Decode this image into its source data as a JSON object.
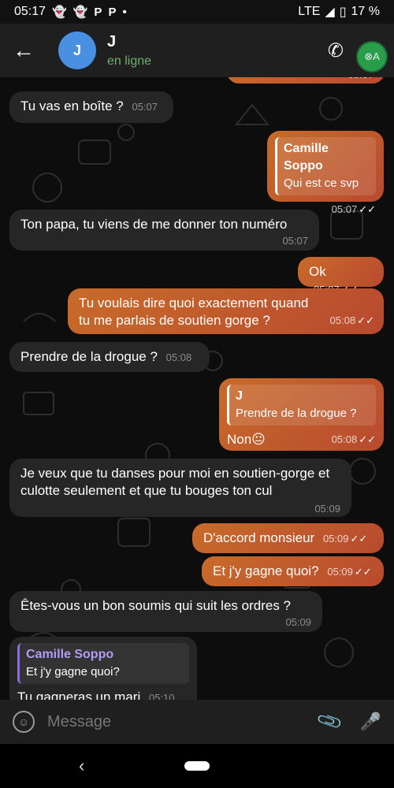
{
  "status_bar": {
    "time": "05:17",
    "icons": [
      "snapchat-icon",
      "snapchat-icon",
      "p-icon",
      "p-icon",
      "dot-icon"
    ],
    "network": "LTE",
    "battery": "17 %"
  },
  "header": {
    "avatar_letter": "J",
    "name": "J",
    "status": "en ligne"
  },
  "messages": [
    {
      "dir": "out",
      "text": "",
      "time": "05:07"
    },
    {
      "dir": "in",
      "text": "Tu vas en boîte ?",
      "time": "05:07"
    },
    {
      "dir": "out",
      "quote_name": "Camille Soppo",
      "quote_text": "Qui est ce svp",
      "text": ".",
      "time": "05:07"
    },
    {
      "dir": "in",
      "text": "Ton papa, tu viens de me donner ton numéro",
      "time": "05:07"
    },
    {
      "dir": "out",
      "text": "Ok",
      "time": "05:07"
    },
    {
      "dir": "out",
      "text": "Tu voulais dire quoi exactement quand tu me parlais de soutien gorge ?",
      "time": "05:08"
    },
    {
      "dir": "in",
      "text": "Prendre de la drogue ?",
      "time": "05:08"
    },
    {
      "dir": "out",
      "quote_name": "J",
      "quote_text": "Prendre de la drogue ?",
      "text": "Non😐",
      "time": "05:08"
    },
    {
      "dir": "in",
      "text": "Je veux que tu danses pour moi en soutien-gorge et culotte seulement et que tu bouges ton cul",
      "time": "05:09"
    },
    {
      "dir": "out",
      "text": "D'accord monsieur",
      "time": "05:09"
    },
    {
      "dir": "out",
      "text": "Et j'y gagne quoi?",
      "time": "05:09"
    },
    {
      "dir": "in",
      "text": "Êtes-vous un bon soumis qui suit les ordres ?",
      "time": "05:09"
    },
    {
      "dir": "in",
      "quote_name": "Camille Soppo",
      "quote_text": "Et j'y gagne quoi?",
      "text": "Tu gagneras un mari",
      "time": "05:10"
    }
  ],
  "input": {
    "placeholder": "Message"
  }
}
